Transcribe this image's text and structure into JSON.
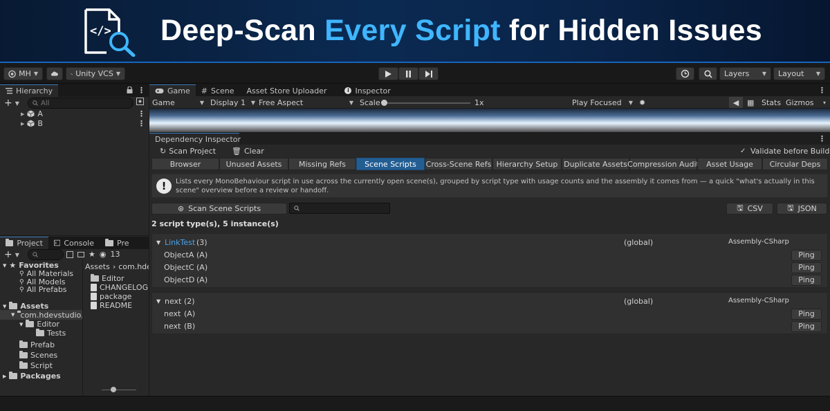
{
  "banner": {
    "title_part1": "Deep-Scan ",
    "title_highlight": "Every Script",
    "title_part2": " for Hidden Issues",
    "icon": "code-file-search-icon",
    "accent": "#3fb6ff"
  },
  "toolbar": {
    "account": "MH",
    "cloud": "cloud-icon",
    "vcs": "Unity VCS",
    "play": "play-icon",
    "pause": "pause-icon",
    "step": "step-icon",
    "history": "history-icon",
    "search": "search-icon",
    "layers": "Layers",
    "layout": "Layout"
  },
  "hierarchy": {
    "tab": "Hierarchy",
    "search_placeholder": "All",
    "items": [
      {
        "label": "A"
      },
      {
        "label": "B"
      }
    ]
  },
  "project": {
    "tabs": [
      "Project",
      "Console",
      "Pre"
    ],
    "count": "13",
    "favorites_label": "Favorites",
    "favorites": [
      "All Materials",
      "All Models",
      "All Prefabs"
    ],
    "assets_label": "Assets",
    "assets_children": [
      "com.hdevstudio.",
      "Editor",
      "Tests",
      "Prefab",
      "Scenes",
      "Script"
    ],
    "packages_label": "Packages",
    "breadcrumb": [
      "Assets",
      "com.hdevs"
    ],
    "files": [
      {
        "name": "Editor",
        "kind": "folder"
      },
      {
        "name": "CHANGELOG",
        "kind": "file"
      },
      {
        "name": "package",
        "kind": "file"
      },
      {
        "name": "README",
        "kind": "file"
      }
    ]
  },
  "game_tabs": [
    {
      "label": "Game",
      "icon": "gamepad-icon"
    },
    {
      "label": "Scene",
      "icon": "grid-icon"
    },
    {
      "label": "Asset Store Uploader",
      "icon": ""
    },
    {
      "label": "Inspector",
      "icon": "info-icon"
    }
  ],
  "game_toolbar": {
    "display_mode": "Game",
    "display": "Display 1",
    "aspect": "Free Aspect",
    "scale_label": "Scale",
    "scale_value": "1x",
    "play_mode": "Play Focused",
    "stats": "Stats",
    "gizmos": "Gizmos"
  },
  "dep": {
    "tab": "Dependency Inspector",
    "scan_project": "Scan Project",
    "clear": "Clear",
    "validate_label": "Validate before Build",
    "validate_checked": true,
    "subtabs": [
      "Browser",
      "Unused Assets",
      "Missing Refs",
      "Scene Scripts",
      "Cross-Scene Refs",
      "Hierarchy Setup",
      "Duplicate Assets",
      "Compression Audit",
      "Asset Usage",
      "Circular Deps"
    ],
    "active_subtab": "Scene Scripts",
    "help": "Lists every MonoBehaviour script in use across the currently open scene(s), grouped by script type with usage counts and the assembly it comes from — a quick \"what's actually in this scene\" overview before a review or handoff.",
    "scan_button": "Scan Scene Scripts",
    "csv": "CSV",
    "json": "JSON",
    "summary": "2 script type(s), 5 instance(s)",
    "groups": [
      {
        "name": "LinkTest",
        "count": "(3)",
        "scope": "(global)",
        "assembly": "Assembly-CSharp",
        "is_link": true,
        "items": [
          {
            "name": "ObjectA",
            "obj": "(A)",
            "ping": "Ping"
          },
          {
            "name": "ObjectC",
            "obj": "(A)",
            "ping": "Ping"
          },
          {
            "name": "ObjectD",
            "obj": "(A)",
            "ping": "Ping"
          }
        ]
      },
      {
        "name": "next",
        "count": "(2)",
        "scope": "(global)",
        "assembly": "Assembly-CSharp",
        "is_link": false,
        "items": [
          {
            "name": "next",
            "obj": "(A)",
            "ping": "Ping"
          },
          {
            "name": "next",
            "obj": "(B)",
            "ping": "Ping"
          }
        ]
      }
    ]
  }
}
